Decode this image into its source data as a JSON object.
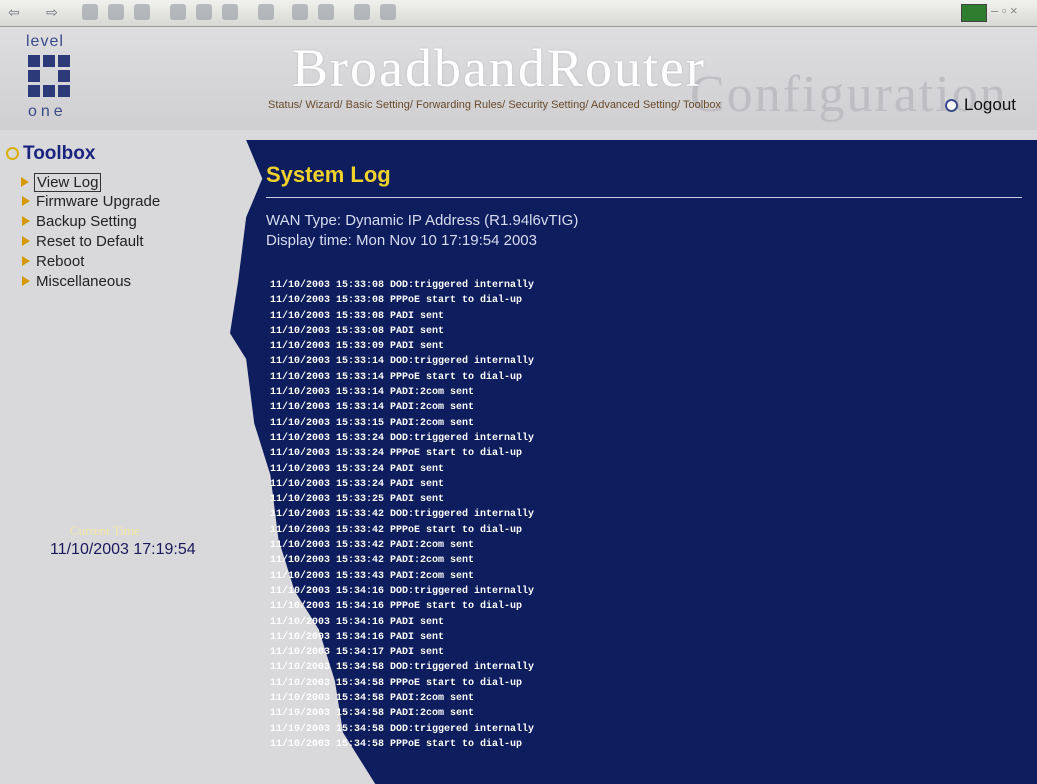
{
  "header": {
    "logo_top": "level",
    "logo_bottom": "one",
    "brand": "BroadbandRouter",
    "brand_sub": "Configuration",
    "nav": [
      "Status/",
      "Wizard/",
      "Basic Setting/",
      "Forwarding Rules/",
      "Security Setting/",
      "Advanced Setting/",
      "Toolbox"
    ],
    "logout": "Logout"
  },
  "sidebar": {
    "title": "Toolbox",
    "items": [
      {
        "label": "View Log",
        "selected": true
      },
      {
        "label": "Firmware Upgrade"
      },
      {
        "label": "Backup Setting"
      },
      {
        "label": "Reset to Default"
      },
      {
        "label": "Reboot"
      },
      {
        "label": "Miscellaneous"
      }
    ],
    "current_time_label": "Current Time",
    "current_time_value": "11/10/2003 17:19:54"
  },
  "main": {
    "title": "System Log",
    "wan_type": "WAN Type: Dynamic IP Address (R1.94l6vTIG)",
    "display_time": "Display time: Mon Nov 10 17:19:54 2003",
    "log_lines": [
      "11/10/2003 15:33:08 DOD:triggered internally",
      "11/10/2003 15:33:08 PPPoE start to dial-up",
      "11/10/2003 15:33:08 PADI sent",
      "11/10/2003 15:33:08 PADI sent",
      "11/10/2003 15:33:09 PADI sent",
      "11/10/2003 15:33:14 DOD:triggered internally",
      "11/10/2003 15:33:14 PPPoE start to dial-up",
      "11/10/2003 15:33:14 PADI:2com sent",
      "11/10/2003 15:33:14 PADI:2com sent",
      "11/10/2003 15:33:15 PADI:2com sent",
      "11/10/2003 15:33:24 DOD:triggered internally",
      "11/10/2003 15:33:24 PPPoE start to dial-up",
      "11/10/2003 15:33:24 PADI sent",
      "11/10/2003 15:33:24 PADI sent",
      "11/10/2003 15:33:25 PADI sent",
      "11/10/2003 15:33:42 DOD:triggered internally",
      "11/10/2003 15:33:42 PPPoE start to dial-up",
      "11/10/2003 15:33:42 PADI:2com sent",
      "11/10/2003 15:33:42 PADI:2com sent",
      "11/10/2003 15:33:43 PADI:2com sent",
      "11/10/2003 15:34:16 DOD:triggered internally",
      "11/10/2003 15:34:16 PPPoE start to dial-up",
      "11/10/2003 15:34:16 PADI sent",
      "11/10/2003 15:34:16 PADI sent",
      "11/10/2003 15:34:17 PADI sent",
      "11/10/2003 15:34:58 DOD:triggered internally",
      "11/10/2003 15:34:58 PPPoE start to dial-up",
      "11/10/2003 15:34:58 PADI:2com sent",
      "11/10/2003 15:34:58 PADI:2com sent",
      "11/10/2003 15:34:58 DOD:triggered internally",
      "11/10/2003 15:34:58 PPPoE start to dial-up"
    ]
  },
  "colors": {
    "panel": "#0d1d5e",
    "title": "#f0d22a",
    "sidebar_bg": "#d9d9dc",
    "accent_icon": "#d49a00"
  }
}
